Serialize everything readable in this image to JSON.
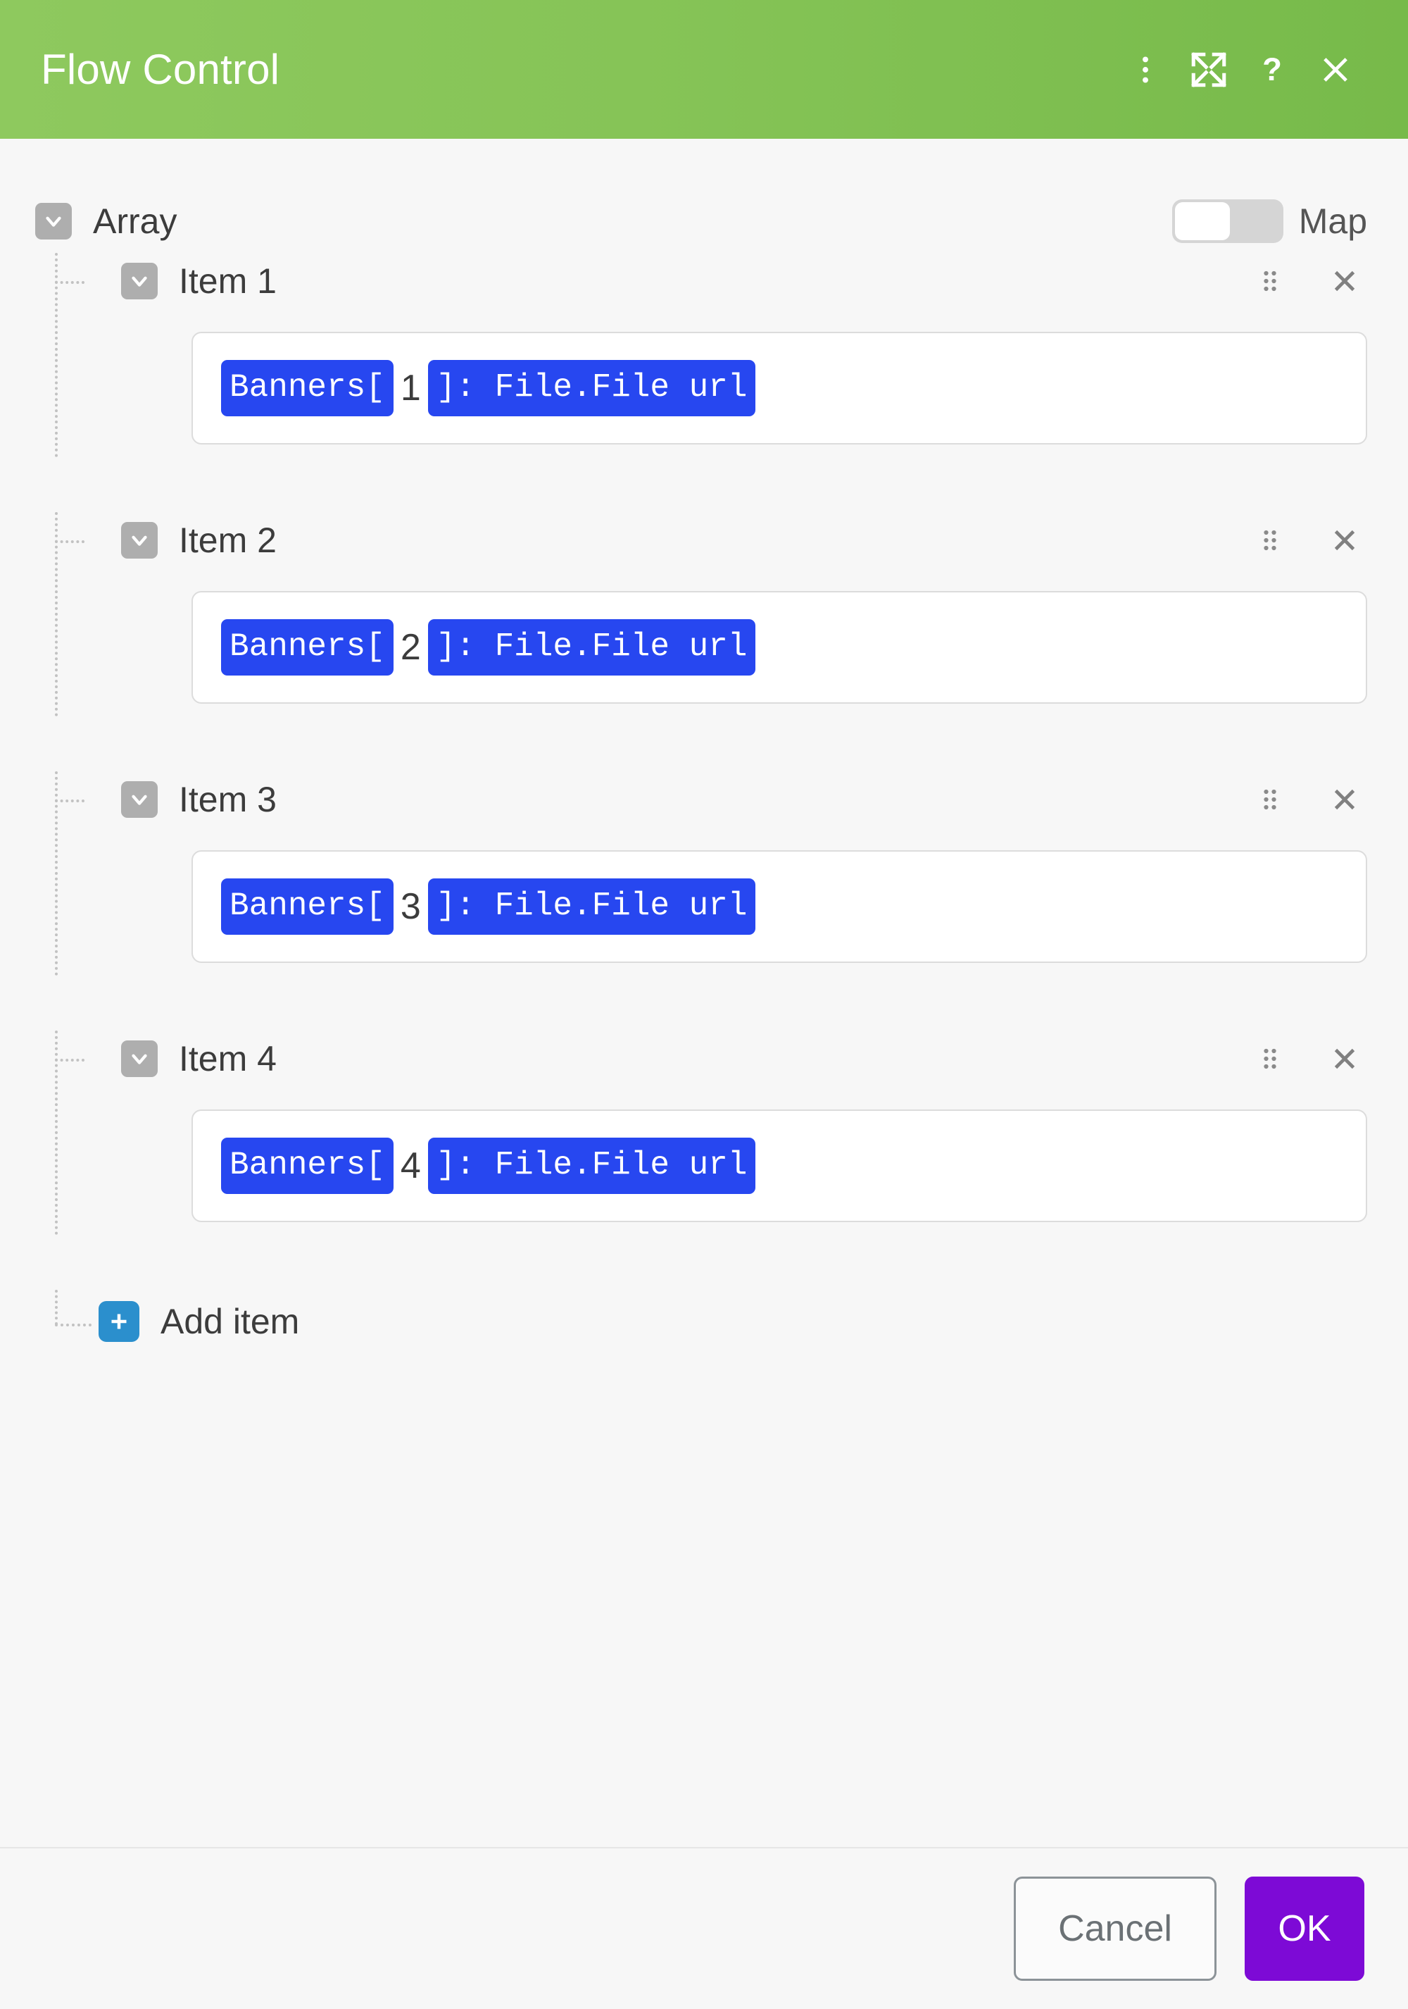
{
  "window": {
    "title": "Flow Control",
    "accent_green_left": "#8ec95e",
    "accent_green_right": "#77ba4a",
    "accent_blue_pill": "#2747f0",
    "accent_purple": "#7d0ad6",
    "accent_add_blue": "#2b8fcd"
  },
  "titlebar": {
    "title": "Flow Control",
    "actions": [
      {
        "name": "menu-icon",
        "label": "More options"
      },
      {
        "name": "expand-icon",
        "label": "Expand"
      },
      {
        "name": "help-icon",
        "label": "Help"
      },
      {
        "name": "close-icon",
        "label": "Close"
      }
    ]
  },
  "array": {
    "label": "Array",
    "collapse_icon": "chevron-down-icon",
    "map_toggle": {
      "label": "Map",
      "state": "off"
    }
  },
  "items": [
    {
      "label": "Item 1",
      "collapse_icon": "chevron-down-icon",
      "drag_icon": "drag-handle-icon",
      "remove_icon": "close-icon",
      "value": {
        "pill_prefix": "Banners[",
        "index": "1",
        "pill_suffix": "]: File.File url"
      }
    },
    {
      "label": "Item 2",
      "collapse_icon": "chevron-down-icon",
      "drag_icon": "drag-handle-icon",
      "remove_icon": "close-icon",
      "value": {
        "pill_prefix": "Banners[",
        "index": "2",
        "pill_suffix": "]: File.File url"
      }
    },
    {
      "label": "Item 3",
      "collapse_icon": "chevron-down-icon",
      "drag_icon": "drag-handle-icon",
      "remove_icon": "close-icon",
      "value": {
        "pill_prefix": "Banners[",
        "index": "3",
        "pill_suffix": "]: File.File url"
      }
    },
    {
      "label": "Item 4",
      "collapse_icon": "chevron-down-icon",
      "drag_icon": "drag-handle-icon",
      "remove_icon": "close-icon",
      "value": {
        "pill_prefix": "Banners[",
        "index": "4",
        "pill_suffix": "]: File.File url"
      }
    }
  ],
  "add_item": {
    "label": "Add item",
    "icon": "plus-icon"
  },
  "footer": {
    "cancel_label": "Cancel",
    "ok_label": "OK"
  }
}
